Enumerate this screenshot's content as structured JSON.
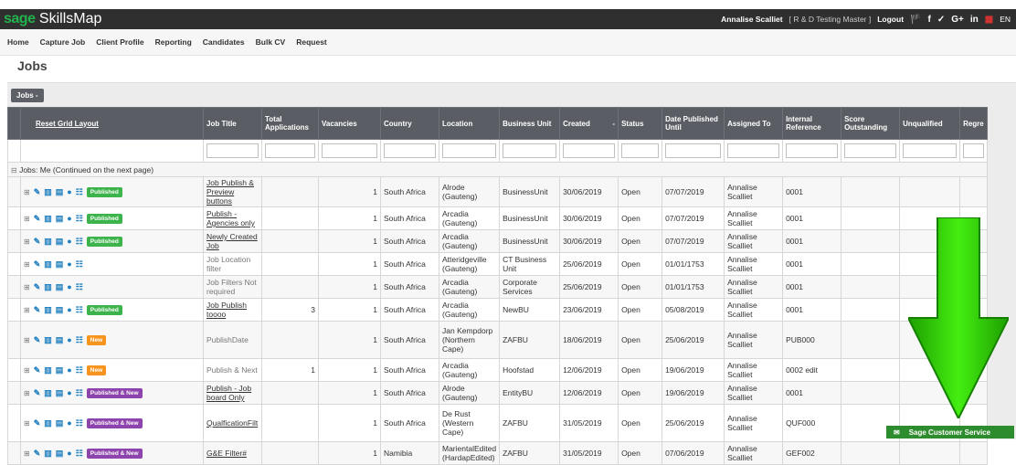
{
  "app": {
    "brand_sage": "sage",
    "brand_rest": " SkillsMap"
  },
  "topbar": {
    "user": "Annalise Scalliet",
    "role": "[ R & D Testing Master ]",
    "logout": "Logout",
    "lang": "EN",
    "icons": {
      "flag": "🏴",
      "facebook": "f",
      "twitter": "✓",
      "google": "G+",
      "linkedin": "in",
      "uk_flag": "▦"
    }
  },
  "nav": [
    "Home",
    "Capture Job",
    "Client Profile",
    "Reporting",
    "Candidates",
    "Bulk CV",
    "Request"
  ],
  "page": {
    "title": "Jobs",
    "jobs_button": "Jobs -"
  },
  "grid": {
    "reset_label": "Reset Grid Layout",
    "headers": {
      "job_title": "Job Title",
      "total_apps": "Total Applications",
      "vacancies": "Vacancies",
      "country": "Country",
      "location": "Location",
      "business_unit": "Business Unit",
      "created": "Created",
      "created_sort": "-",
      "status": "Status",
      "published_until": "Date Published Until",
      "assigned_to": "Assigned To",
      "internal_ref": "Internal Reference",
      "score_outstanding": "Score Outstanding",
      "unqualified": "Unqualified",
      "regret": "Regre"
    },
    "group_label": "Jobs: Me (Continued on the next page)",
    "rows": [
      {
        "badge": "Published",
        "job_title": "Job Publish & Preview buttons",
        "title_style": "link",
        "total": "",
        "vacancies": "1",
        "country": "South Africa",
        "location": "Alrode (Gauteng)",
        "bu": "BusinessUnit",
        "created": "30/06/2019",
        "status": "Open",
        "until": "07/07/2019",
        "assigned": "Annalise Scalliet",
        "ref": "0001"
      },
      {
        "badge": "Published",
        "job_title": "Publish - Agencies only",
        "title_style": "link",
        "total": "",
        "vacancies": "1",
        "country": "South Africa",
        "location": "Arcadia (Gauteng)",
        "bu": "BusinessUnit",
        "created": "30/06/2019",
        "status": "Open",
        "until": "07/07/2019",
        "assigned": "Annalise Scalliet",
        "ref": "0001"
      },
      {
        "badge": "Published",
        "job_title": "Newly Created Job",
        "title_style": "link",
        "total": "",
        "vacancies": "1",
        "country": "South Africa",
        "location": "Arcadia (Gauteng)",
        "bu": "BusinessUnit",
        "created": "30/06/2019",
        "status": "Open",
        "until": "07/07/2019",
        "assigned": "Annalise Scalliet",
        "ref": "0001"
      },
      {
        "badge": "",
        "job_title": "Job Location filter",
        "title_style": "grey",
        "total": "",
        "vacancies": "1",
        "country": "South Africa",
        "location": "Atteridgeville (Gauteng)",
        "bu": "CT Business Unit",
        "created": "25/06/2019",
        "status": "Open",
        "until": "01/01/1753",
        "assigned": "Annalise Scalliet",
        "ref": "0001"
      },
      {
        "badge": "",
        "job_title": "Job Filters Not required",
        "title_style": "grey",
        "total": "",
        "vacancies": "1",
        "country": "South Africa",
        "location": "Arcadia (Gauteng)",
        "bu": "Corporate Services",
        "created": "25/06/2019",
        "status": "Open",
        "until": "01/01/1753",
        "assigned": "Annalise Scalliet",
        "ref": "0001"
      },
      {
        "badge": "Published",
        "job_title": "Job Publish toooo",
        "title_style": "link",
        "total": "3",
        "vacancies": "1",
        "country": "South Africa",
        "location": "Arcadia (Gauteng)",
        "bu": "NewBU",
        "created": "23/06/2019",
        "status": "Open",
        "until": "05/08/2019",
        "assigned": "Annalise Scalliet",
        "ref": "0001"
      },
      {
        "badge": "New",
        "job_title": "PublishDate",
        "title_style": "grey",
        "total": "",
        "vacancies": "1",
        "country": "South Africa",
        "location": "Jan Kempdorp (Northern Cape)",
        "bu": "ZAFBU",
        "created": "18/06/2019",
        "status": "Open",
        "until": "25/06/2019",
        "assigned": "Annalise Scalliet",
        "ref": "PUB000",
        "tall": true
      },
      {
        "badge": "New",
        "job_title": "Publish & Next",
        "title_style": "grey",
        "total": "1",
        "vacancies": "1",
        "country": "South Africa",
        "location": "Arcadia (Gauteng)",
        "bu": "Hoofstad",
        "created": "12/06/2019",
        "status": "Open",
        "until": "19/06/2019",
        "assigned": "Annalise Scalliet",
        "ref": "0002 edit"
      },
      {
        "badge": "Published & New",
        "job_title": "Publish - Job board Only",
        "title_style": "link",
        "total": "",
        "vacancies": "1",
        "country": "South Africa",
        "location": "Alrode (Gauteng)",
        "bu": "EntityBU",
        "created": "12/06/2019",
        "status": "Open",
        "until": "19/06/2019",
        "assigned": "Annalise Scalliet",
        "ref": "0001"
      },
      {
        "badge": "Published & New",
        "job_title": "QualficationFilt",
        "title_style": "link",
        "total": "",
        "vacancies": "1",
        "country": "South Africa",
        "location": "De Rust (Western Cape)",
        "bu": "ZAFBU",
        "created": "31/05/2019",
        "status": "Open",
        "until": "25/06/2019",
        "assigned": "Annalise Scalliet",
        "ref": "QUF000",
        "tall": true
      },
      {
        "badge": "Published & New",
        "job_title": "G&E Filter#",
        "title_style": "link",
        "total": "",
        "vacancies": "1",
        "country": "Namibia",
        "location": "MarientalEdited (HardapEdited)",
        "bu": "ZAFBU",
        "created": "31/05/2019",
        "status": "Open",
        "until": "07/06/2019",
        "assigned": "Annalise Scalliet",
        "ref": "GEF002"
      }
    ]
  },
  "service": {
    "label": "Sage Customer Service",
    "icon": "✉"
  },
  "colors": {
    "topbar": "#2f2f2f",
    "brand_green": "#22b14c",
    "published": "#3cb44b",
    "new": "#f7941d",
    "published_new": "#8e44ad",
    "arrow": "#33cc00"
  }
}
